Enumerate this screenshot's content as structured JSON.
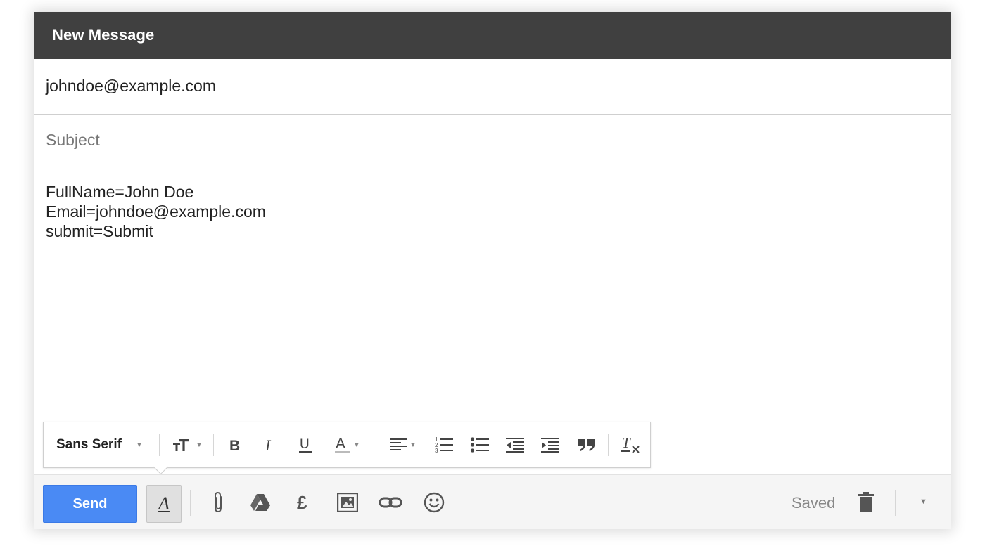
{
  "window": {
    "title": "New Message"
  },
  "fields": {
    "to_value": "johndoe@example.com",
    "subject_placeholder": "Subject",
    "subject_value": ""
  },
  "body": {
    "lines": [
      "FullName=John Doe",
      "Email=johndoe@example.com",
      "submit=Submit"
    ]
  },
  "format_toolbar": {
    "font_family": "Sans Serif",
    "icons": [
      "font-size-icon",
      "bold-icon",
      "italic-icon",
      "underline-icon",
      "text-color-icon",
      "align-icon",
      "numbered-list-icon",
      "bulleted-list-icon",
      "indent-less-icon",
      "indent-more-icon",
      "quote-icon",
      "remove-formatting-icon"
    ]
  },
  "bottom_bar": {
    "send_label": "Send",
    "saved_label": "Saved",
    "icons": [
      "formatting-options-icon",
      "attach-icon",
      "drive-icon",
      "money-icon",
      "photo-icon",
      "link-icon",
      "emoji-icon",
      "trash-icon",
      "more-options-icon"
    ]
  },
  "colors": {
    "title_bar": "#404040",
    "send_button": "#4a8af4",
    "toolbar_bg": "#f5f5f5"
  }
}
